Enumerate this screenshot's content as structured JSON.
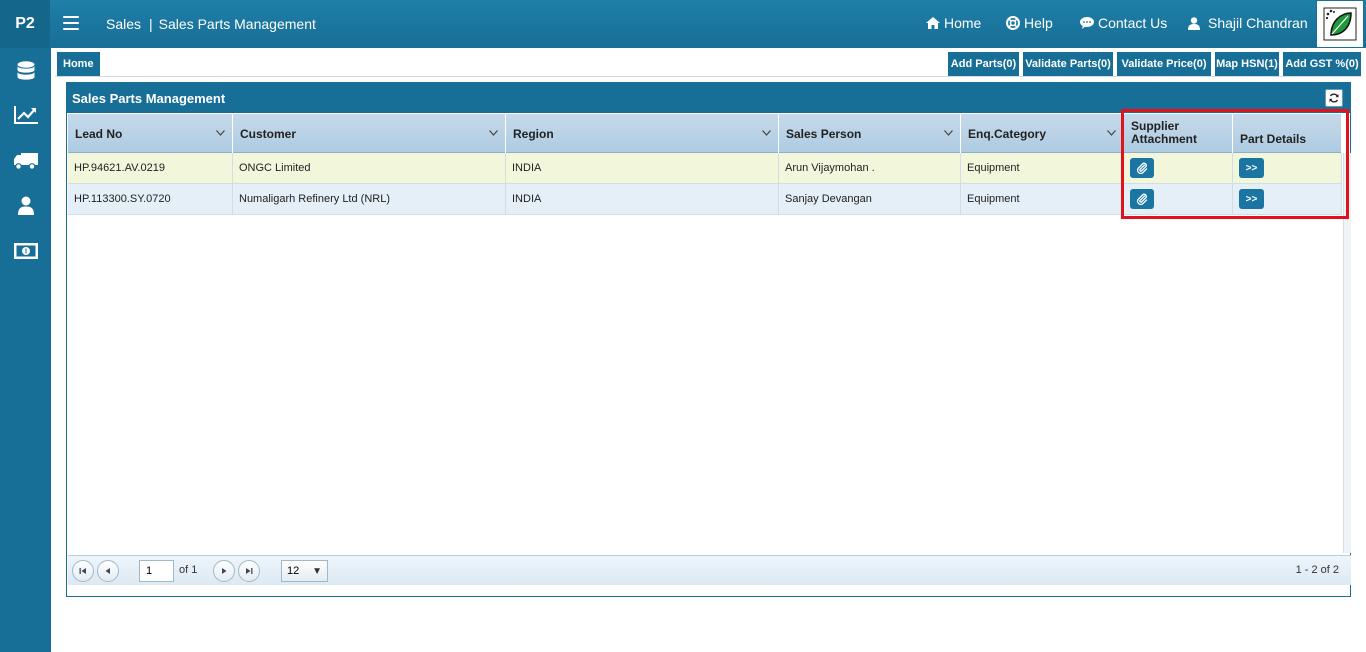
{
  "topbar": {
    "logo_text": "P2",
    "breadcrumb_module": "Sales",
    "breadcrumb_separator": "|",
    "breadcrumb_page": "Sales Parts Management",
    "nav": {
      "home": "Home",
      "help": "Help",
      "contact": "Contact Us",
      "user": "Shajil Chandran"
    }
  },
  "sidebar": {
    "items": [
      "database-icon",
      "chart-icon",
      "truck-icon",
      "user-icon",
      "money-icon"
    ]
  },
  "tabs": {
    "home_label": "Home"
  },
  "actions": {
    "add_parts": "Add Parts(0)",
    "validate_parts": "Validate Parts(0)",
    "validate_price": "Validate Price(0)",
    "map_hsn": "Map HSN(1)",
    "add_gst": "Add GST %(0)"
  },
  "panel": {
    "title": "Sales Parts Management"
  },
  "grid": {
    "columns": {
      "lead_no": "Lead No",
      "customer": "Customer",
      "region": "Region",
      "sales_person": "Sales Person",
      "category": "Enq.Category",
      "supplier_attachment_1": "Supplier",
      "supplier_attachment_2": "Attachment",
      "part_details": "Part Details"
    },
    "rows": [
      {
        "lead_no": "HP.94621.AV.0219",
        "customer": "ONGC Limited",
        "region": "INDIA",
        "sales_person": "Arun Vijaymohan .",
        "category": "Equipment",
        "details_btn": ">>"
      },
      {
        "lead_no": "HP.113300.SY.0720",
        "customer": "Numaligarh Refinery Ltd (NRL)",
        "region": "INDIA",
        "sales_person": "Sanjay Devangan",
        "category": "Equipment",
        "details_btn": ">>"
      }
    ]
  },
  "pager": {
    "page_value": "1",
    "of_label": "of 1",
    "page_size": "12",
    "range": "1 - 2 of 2"
  },
  "colors": {
    "primary": "#176e96",
    "highlight": "#e0121b"
  }
}
